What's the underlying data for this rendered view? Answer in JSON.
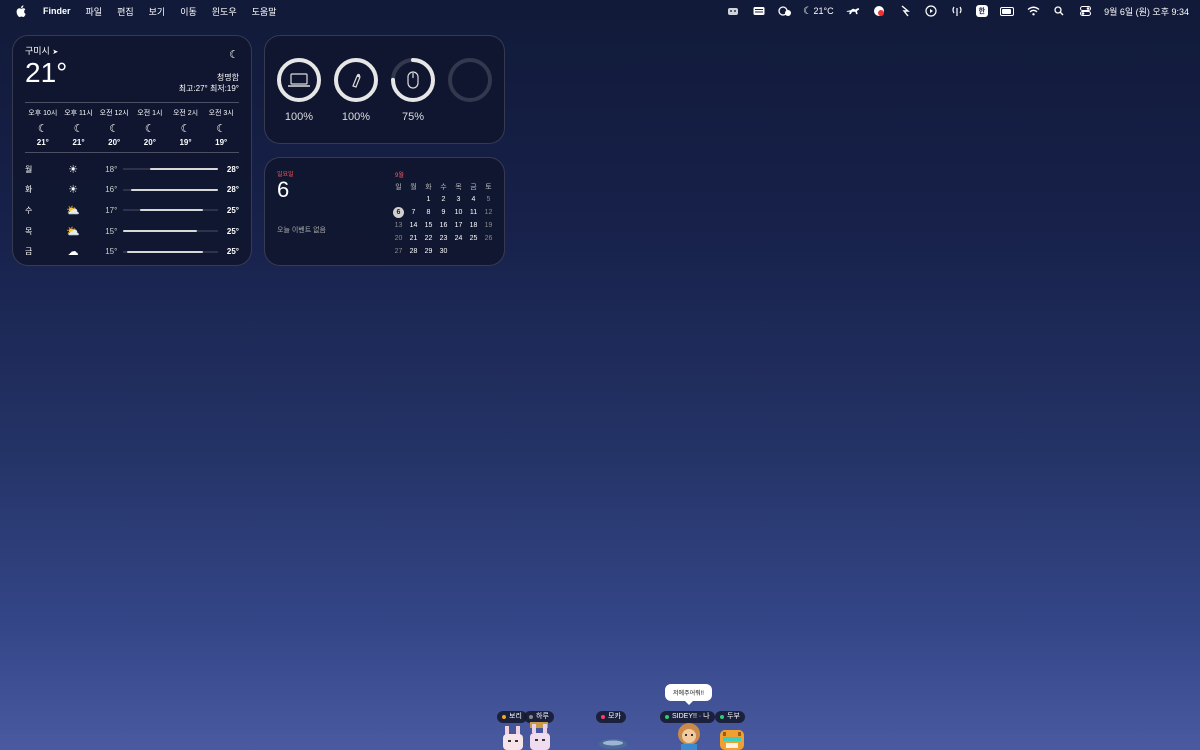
{
  "menubar": {
    "app_name": "Finder",
    "menus": [
      "파일",
      "편집",
      "보기",
      "이동",
      "윈도우",
      "도움말"
    ],
    "weather_temp": "21°C",
    "input_method": "한",
    "datetime": "9월 6일 (원) 오후 9:34"
  },
  "weather": {
    "city": "구미시",
    "temp": "21°",
    "condition": "청명함",
    "high_low": "최고:27° 최저:19°",
    "hourly": [
      {
        "time": "오후 10시",
        "temp": "21°"
      },
      {
        "time": "오후 11시",
        "temp": "21°"
      },
      {
        "time": "오전 12시",
        "temp": "20°"
      },
      {
        "time": "오전 1시",
        "temp": "20°"
      },
      {
        "time": "오전 2시",
        "temp": "19°"
      },
      {
        "time": "오전 3시",
        "temp": "19°"
      }
    ],
    "daily": [
      {
        "day": "월",
        "icon": "sun-icon",
        "low": "18°",
        "high": "28°",
        "range": [
          0.28,
          1.0
        ]
      },
      {
        "day": "화",
        "icon": "sun-icon",
        "low": "16°",
        "high": "28°",
        "range": [
          0.08,
          1.0
        ]
      },
      {
        "day": "수",
        "icon": "partly-cloudy-icon",
        "low": "17°",
        "high": "25°",
        "range": [
          0.18,
          0.84
        ]
      },
      {
        "day": "목",
        "icon": "partly-cloudy-icon",
        "low": "15°",
        "high": "25°",
        "range": [
          0.0,
          0.78
        ]
      },
      {
        "day": "금",
        "icon": "cloud-icon",
        "low": "15°",
        "high": "25°",
        "range": [
          0.04,
          0.84
        ]
      }
    ]
  },
  "batteries": [
    {
      "device": "laptop-icon",
      "percent": "100%",
      "level": 1.0
    },
    {
      "device": "pencil-icon",
      "percent": "100%",
      "level": 1.0
    },
    {
      "device": "mouse-icon",
      "percent": "75%",
      "level": 0.75
    },
    {
      "device": "empty-slot",
      "percent": "",
      "level": 0
    }
  ],
  "calendar": {
    "weekday": "일요일",
    "day": "6",
    "no_events": "오늘 이벤트 없음",
    "month": "9월",
    "headers": [
      "일",
      "월",
      "화",
      "수",
      "목",
      "금",
      "토"
    ],
    "weeks": [
      [
        "",
        "",
        "1",
        "2",
        "3",
        "4",
        "5"
      ],
      [
        "6",
        "7",
        "8",
        "9",
        "10",
        "11",
        "12"
      ],
      [
        "13",
        "14",
        "15",
        "16",
        "17",
        "18",
        "19"
      ],
      [
        "20",
        "21",
        "22",
        "23",
        "24",
        "25",
        "26"
      ],
      [
        "27",
        "28",
        "29",
        "30",
        "",
        "",
        ""
      ]
    ]
  },
  "pets": {
    "speech": "저에주어줘!!",
    "labels": [
      {
        "name": "보리",
        "color": "#f5a623"
      },
      {
        "name": "하루",
        "color": "#888888"
      },
      {
        "name": "모카",
        "color": "#ff3b6b"
      },
      {
        "name": "SIDEY!! · 나",
        "color": "#2ecc71"
      },
      {
        "name": "두부",
        "color": "#2ecc71"
      }
    ]
  }
}
